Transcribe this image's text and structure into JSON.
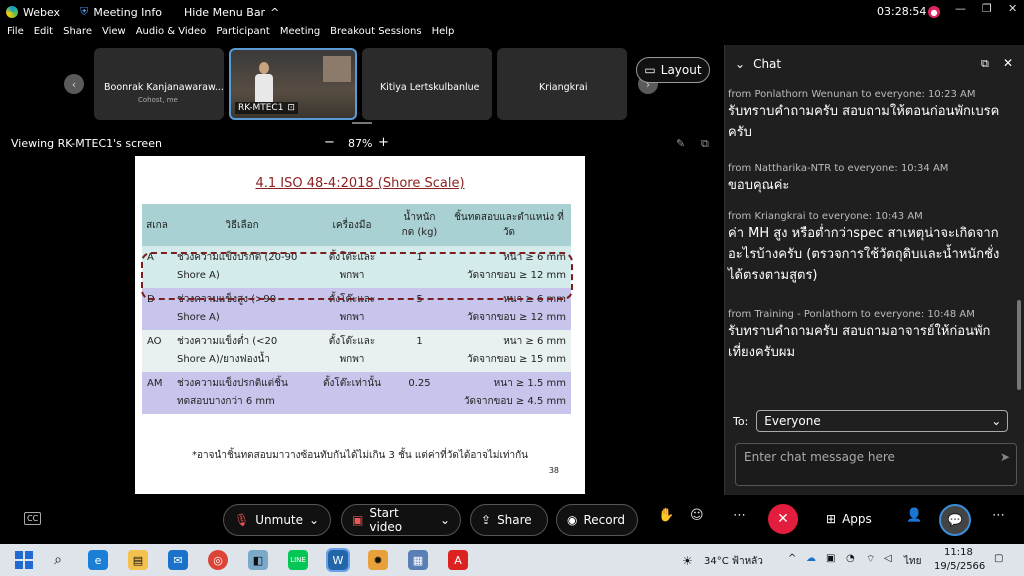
{
  "titlebar": {
    "app_name": "Webex",
    "meeting_info": "Meeting Info",
    "hide_menu": "Hide Menu Bar",
    "timer": "03:28:54"
  },
  "menu": [
    "File",
    "Edit",
    "Share",
    "View",
    "Audio & Video",
    "Participant",
    "Meeting",
    "Breakout Sessions",
    "Help"
  ],
  "participants": {
    "tile1_name": "Boonrak Kanjanawaraw...",
    "tile1_sub": "Cohost, me",
    "tile2_name": "RK-MTEC1",
    "tile3_name": "Kitiya Lertskulbanlue",
    "tile4_name": "Kriangkrai",
    "layout_label": "Layout"
  },
  "viewbar": {
    "viewing": "Viewing RK-MTEC1's screen",
    "zoom": "87%"
  },
  "slide": {
    "title": "4.1 ISO 48-4:2018 (Shore Scale)",
    "headers": [
      "สเกล",
      "วิธีเลือก",
      "เครื่องมือ",
      "น้ำหนัก กด (kg)",
      "ชิ้นทดสอบและตำแหน่ง ที่วัด"
    ],
    "rows": [
      [
        "A",
        "ช่วงความแข็งปรกติ (20-90 Shore A)",
        "ตั้งโต๊ะและ พกพา",
        "1",
        "หนา ≥ 6 mm",
        "วัดจากขอบ ≥ 12 mm"
      ],
      [
        "D",
        "ช่วงความแข็งสูง (>90 Shore A)",
        "ตั้งโต๊ะและ พกพา",
        "5",
        "หนา ≥ 6 mm",
        "วัดจากขอบ ≥ 12 mm"
      ],
      [
        "AO",
        "ช่วงความแข็งต่ำ (<20 Shore A)/ยางฟองน้ำ",
        "ตั้งโต๊ะและ พกพา",
        "1",
        "หนา ≥ 6 mm",
        "วัดจากขอบ ≥ 15 mm"
      ],
      [
        "AM",
        "ช่วงความแข็งปรกติแต่ชิ้น ทดสอบบางกว่า 6 mm",
        "ตั้งโต๊ะเท่านั้น",
        "0.25",
        "หนา ≥ 1.5 mm",
        "วัดจากขอบ ≥ 4.5 mm"
      ]
    ],
    "note": "*อาจนำชิ้นทดสอบมาวางซ้อนทับกันได้ไม่เกิน 3 ชั้น แต่ค่าที่วัดได้อาจไม่เท่ากัน",
    "page": "38"
  },
  "chat": {
    "title": "Chat",
    "messages": [
      {
        "meta": "from Ponlathorn Wenunan to everyone:   10:23 AM",
        "text": "รับทราบคำถามครับ สอบถามให้ตอนก่อนพักเบรคครับ"
      },
      {
        "meta": "from Nattharika-NTR to everyone:   10:34 AM",
        "text": "ขอบคุณค่ะ"
      },
      {
        "meta": "from Kriangkrai to everyone:   10:43 AM",
        "text": "ค่า MH สูง หรือต่ำกว่าspec สาเหตุน่าจะเกิดจากอะไรบ้างครับ (ตรวจการใช้วัตถุดิบและน้ำหนักชั่งได้ตรงตามสูตร)"
      },
      {
        "meta": "from Training - Ponlathorn to everyone:   10:48 AM",
        "text": "รับทราบคำถามครับ สอบถามอาจารย์ให้ก่อนพักเที่ยงครับผม"
      }
    ],
    "to_label": "To:",
    "to_value": "Everyone",
    "input_placeholder": "Enter chat message here"
  },
  "controls": {
    "unmute": "Unmute",
    "start_video": "Start video",
    "share": "Share",
    "record": "Record",
    "apps": "Apps"
  },
  "taskbar": {
    "weather": "34°C  ฟ้าหลัว",
    "lang": "ไทย",
    "time": "11:18",
    "date": "19/5/2566"
  }
}
